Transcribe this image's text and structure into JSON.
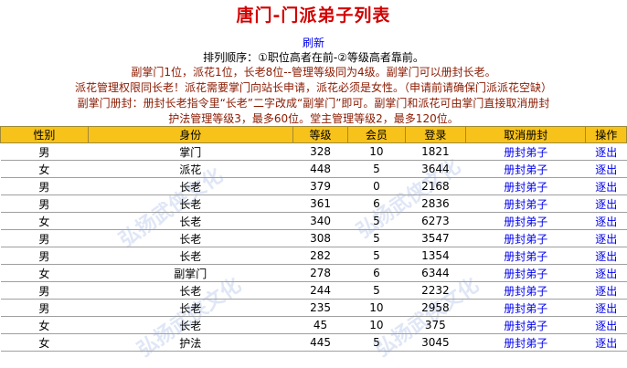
{
  "page": {
    "title": "唐门-门派弟子列表",
    "refresh_label": "刷新",
    "rules": [
      "排列顺序：①职位高者在前-②等级高者靠前。",
      "副掌门1位，派花1位，长老8位--管理等级同为4级。副掌门可以册封长老。",
      "派花管理权限同长老！派花需要掌门向站长申请，派花必须是女性。（申请前请确保门派派花空缺）",
      "副掌门册封：册封长老指令里“长老”二字改成“副掌门”即可。副掌门和派花可由掌门直接取消册封",
      "护法管理等级3，最多60位。堂主管理等级2，最多120位。"
    ],
    "watermark": "弘扬武侠文化"
  },
  "table": {
    "headers": [
      "性别",
      "身份",
      "等级",
      "会员",
      "登录",
      "取消册封",
      "操作"
    ],
    "rows": [
      {
        "gender": "男",
        "role": "掌门",
        "level": "328",
        "vip": "10",
        "login": "1821",
        "cancel": "册封弟子",
        "action": "逐出"
      },
      {
        "gender": "女",
        "role": "派花",
        "level": "448",
        "vip": "5",
        "login": "3644",
        "cancel": "册封弟子",
        "action": "逐出"
      },
      {
        "gender": "男",
        "role": "长老",
        "level": "379",
        "vip": "0",
        "login": "2168",
        "cancel": "册封弟子",
        "action": "逐出"
      },
      {
        "gender": "男",
        "role": "长老",
        "level": "361",
        "vip": "6",
        "login": "2836",
        "cancel": "册封弟子",
        "action": "逐出"
      },
      {
        "gender": "女",
        "role": "长老",
        "level": "340",
        "vip": "5",
        "login": "6273",
        "cancel": "册封弟子",
        "action": "逐出"
      },
      {
        "gender": "男",
        "role": "长老",
        "level": "308",
        "vip": "5",
        "login": "3547",
        "cancel": "册封弟子",
        "action": "逐出"
      },
      {
        "gender": "男",
        "role": "长老",
        "level": "282",
        "vip": "5",
        "login": "1354",
        "cancel": "册封弟子",
        "action": "逐出"
      },
      {
        "gender": "女",
        "role": "副掌门",
        "level": "278",
        "vip": "6",
        "login": "6344",
        "cancel": "册封弟子",
        "action": "逐出"
      },
      {
        "gender": "男",
        "role": "长老",
        "level": "244",
        "vip": "5",
        "login": "2232",
        "cancel": "册封弟子",
        "action": "逐出"
      },
      {
        "gender": "男",
        "role": "长老",
        "level": "235",
        "vip": "10",
        "login": "2958",
        "cancel": "册封弟子",
        "action": "逐出"
      },
      {
        "gender": "女",
        "role": "长老",
        "level": "45",
        "vip": "10",
        "login": "375",
        "cancel": "册封弟子",
        "action": "逐出"
      },
      {
        "gender": "女",
        "role": "护法",
        "level": "445",
        "vip": "5",
        "login": "3045",
        "cancel": "册封弟子",
        "action": "逐出"
      }
    ]
  }
}
